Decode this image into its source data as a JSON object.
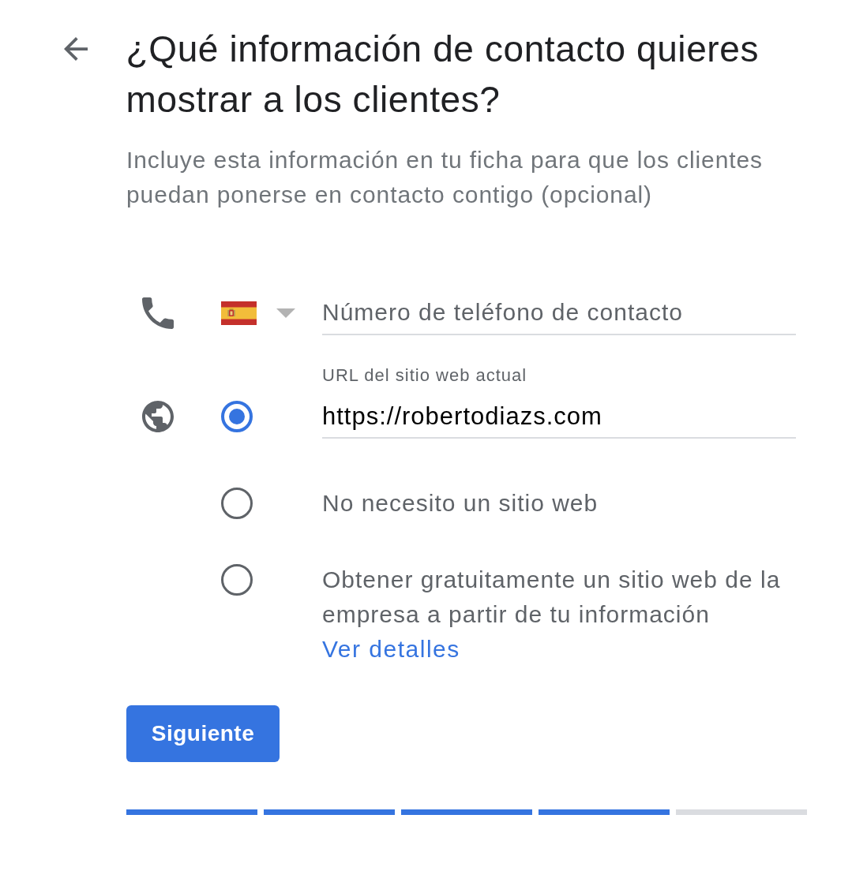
{
  "title": "¿Qué información de contacto quieres mostrar a los clientes?",
  "subtitle": "Incluye esta información en tu ficha para que los clientes puedan ponerse en contacto contigo (opcional)",
  "phone": {
    "placeholder": "Número de teléfono de contacto"
  },
  "website_options": [
    {
      "kind": "url",
      "selected": true,
      "label": "URL del sitio web actual",
      "value": "https://robertodiazs.com"
    },
    {
      "kind": "text",
      "selected": false,
      "text": "No necesito un sitio web"
    },
    {
      "kind": "text",
      "selected": false,
      "text": "Obtener gratuitamente un sitio web de la empresa a partir de tu información",
      "link": "Ver detalles"
    }
  ],
  "next_button": "Siguiente",
  "progress_steps": [
    {
      "completed": true
    },
    {
      "completed": true
    },
    {
      "completed": true
    },
    {
      "completed": true
    },
    {
      "completed": false
    }
  ]
}
